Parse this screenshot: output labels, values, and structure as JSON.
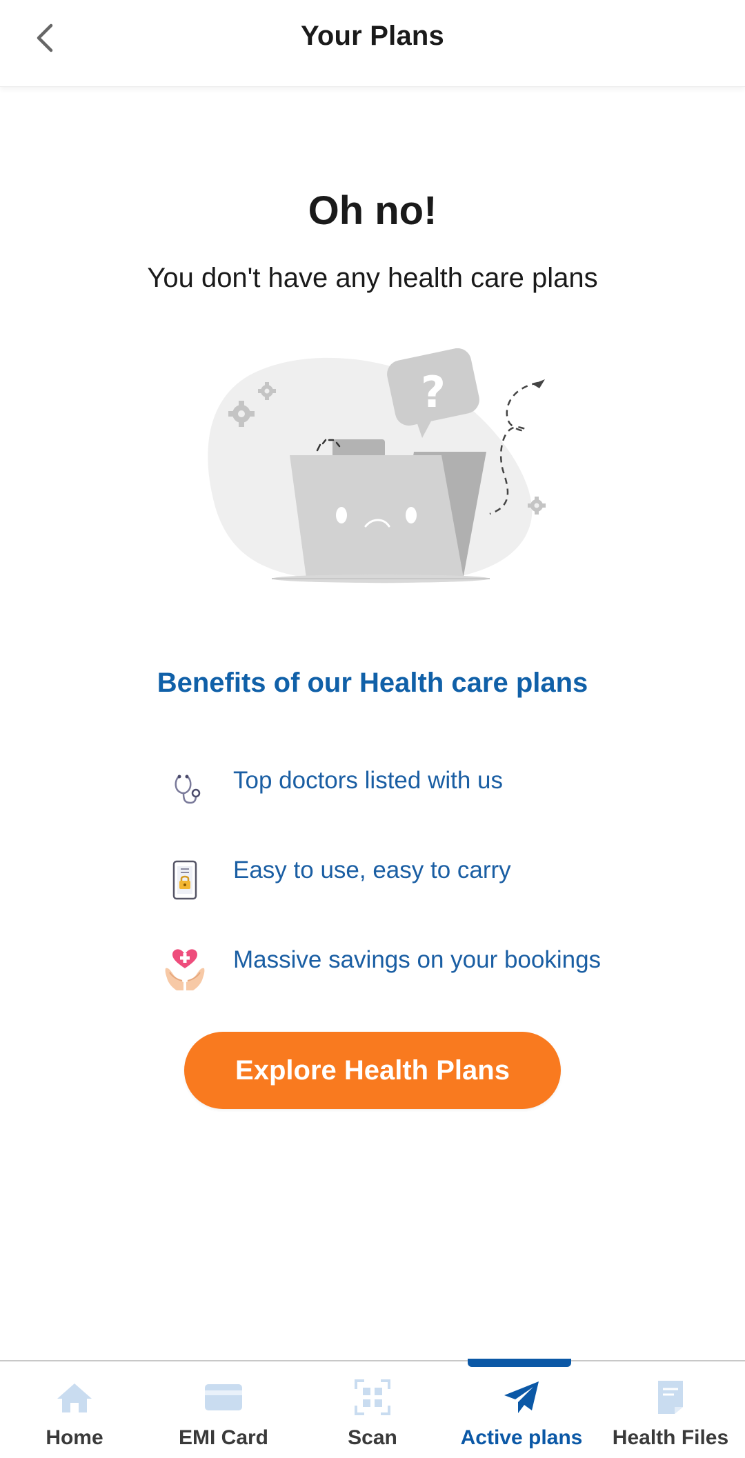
{
  "header": {
    "title": "Your Plans",
    "back_icon": "chevron-left-icon"
  },
  "empty_state": {
    "heading": "Oh no!",
    "message": "You don't have any health care plans",
    "illustration": "sad-empty-folder-illustration",
    "illustration_symbol": "?"
  },
  "benefits": {
    "title": "Benefits of our Health care plans",
    "items": [
      {
        "icon": "stethoscope-icon",
        "label": "Top doctors listed with us"
      },
      {
        "icon": "phone-lock-icon",
        "label": "Easy to use, easy to carry"
      },
      {
        "icon": "heart-in-hands-icon",
        "label": "Massive savings on your bookings"
      }
    ]
  },
  "cta": {
    "label": "Explore Health Plans"
  },
  "bottom_nav": {
    "active_index": 3,
    "items": [
      {
        "label": "Home",
        "icon": "home-icon"
      },
      {
        "label": "EMI Card",
        "icon": "card-icon"
      },
      {
        "label": "Scan",
        "icon": "scan-icon"
      },
      {
        "label": "Active plans",
        "icon": "paper-plane-icon"
      },
      {
        "label": "Health Files",
        "icon": "document-icon"
      }
    ]
  },
  "colors": {
    "accent_blue": "#1060a8",
    "nav_active": "#0b58a6",
    "cta_orange": "#f97a1f",
    "nav_inactive_icon": "#c9dcf0"
  }
}
